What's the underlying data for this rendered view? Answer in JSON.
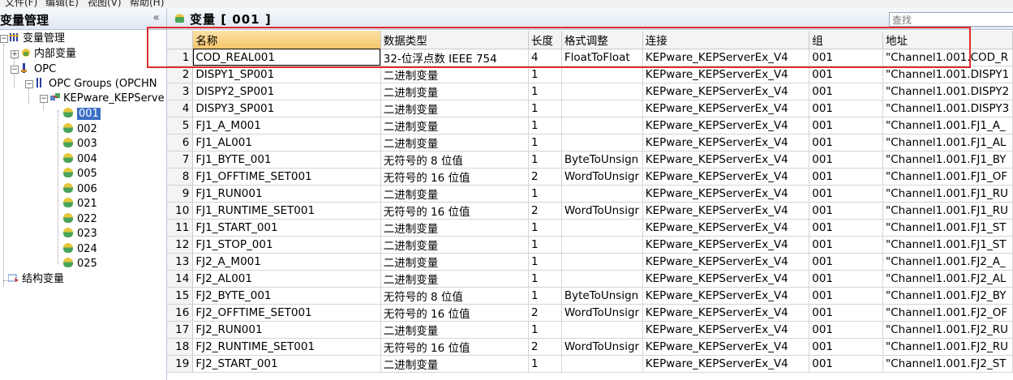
{
  "menu": {
    "items": [
      "文件(F)",
      "编辑(E)",
      "视图(V)",
      "帮助(H)"
    ]
  },
  "left_panel": {
    "title": "变量管理",
    "collapse_glyph": "«",
    "tree": {
      "root": "变量管理",
      "internal": "内部变量",
      "opc": "OPC",
      "opc_groups": "OPC Groups (OPCHN",
      "server": "KEPware_KEPServe",
      "groups": [
        "001",
        "002",
        "003",
        "004",
        "005",
        "006",
        "021",
        "022",
        "023",
        "024",
        "025"
      ],
      "struct": "结构变量"
    }
  },
  "right_panel": {
    "title": "变量 [ 001 ]",
    "search_placeholder": "查找",
    "columns": [
      "名称",
      "数据类型",
      "长度",
      "格式调整",
      "连接",
      "组",
      "地址"
    ],
    "rows": [
      [
        "1",
        "COD_REAL001",
        "32-位浮点数 IEEE 754",
        "4",
        "FloatToFloat",
        "KEPware_KEPServerEx_V4",
        "001",
        "\"Channel1.001.COD_R"
      ],
      [
        "2",
        "DISPY1_SP001",
        "二进制变量",
        "1",
        "",
        "KEPware_KEPServerEx_V4",
        "001",
        "\"Channel1.001.DISPY1"
      ],
      [
        "3",
        "DISPY2_SP001",
        "二进制变量",
        "1",
        "",
        "KEPware_KEPServerEx_V4",
        "001",
        "\"Channel1.001.DISPY2"
      ],
      [
        "4",
        "DISPY3_SP001",
        "二进制变量",
        "1",
        "",
        "KEPware_KEPServerEx_V4",
        "001",
        "\"Channel1.001.DISPY3"
      ],
      [
        "5",
        "FJ1_A_M001",
        "二进制变量",
        "1",
        "",
        "KEPware_KEPServerEx_V4",
        "001",
        "\"Channel1.001.FJ1_A_"
      ],
      [
        "6",
        "FJ1_AL001",
        "二进制变量",
        "1",
        "",
        "KEPware_KEPServerEx_V4",
        "001",
        "\"Channel1.001.FJ1_AL"
      ],
      [
        "7",
        "FJ1_BYTE_001",
        "无符号的 8 位值",
        "1",
        "ByteToUnsign",
        "KEPware_KEPServerEx_V4",
        "001",
        "\"Channel1.001.FJ1_BY"
      ],
      [
        "8",
        "FJ1_OFFTIME_SET001",
        "无符号的 16 位值",
        "2",
        "WordToUnsigr",
        "KEPware_KEPServerEx_V4",
        "001",
        "\"Channel1.001.FJ1_OF"
      ],
      [
        "9",
        "FJ1_RUN001",
        "二进制变量",
        "1",
        "",
        "KEPware_KEPServerEx_V4",
        "001",
        "\"Channel1.001.FJ1_RU"
      ],
      [
        "10",
        "FJ1_RUNTIME_SET001",
        "无符号的 16 位值",
        "2",
        "WordToUnsigr",
        "KEPware_KEPServerEx_V4",
        "001",
        "\"Channel1.001.FJ1_RU"
      ],
      [
        "11",
        "FJ1_START_001",
        "二进制变量",
        "1",
        "",
        "KEPware_KEPServerEx_V4",
        "001",
        "\"Channel1.001.FJ1_ST"
      ],
      [
        "12",
        "FJ1_STOP_001",
        "二进制变量",
        "1",
        "",
        "KEPware_KEPServerEx_V4",
        "001",
        "\"Channel1.001.FJ1_ST"
      ],
      [
        "13",
        "FJ2_A_M001",
        "二进制变量",
        "1",
        "",
        "KEPware_KEPServerEx_V4",
        "001",
        "\"Channel1.001.FJ2_A_"
      ],
      [
        "14",
        "FJ2_AL001",
        "二进制变量",
        "1",
        "",
        "KEPware_KEPServerEx_V4",
        "001",
        "\"Channel1.001.FJ2_AL"
      ],
      [
        "15",
        "FJ2_BYTE_001",
        "无符号的 8 位值",
        "1",
        "ByteToUnsign",
        "KEPware_KEPServerEx_V4",
        "001",
        "\"Channel1.001.FJ2_BY"
      ],
      [
        "16",
        "FJ2_OFFTIME_SET001",
        "无符号的 16 位值",
        "2",
        "WordToUnsigr",
        "KEPware_KEPServerEx_V4",
        "001",
        "\"Channel1.001.FJ2_OF"
      ],
      [
        "17",
        "FJ2_RUN001",
        "二进制变量",
        "1",
        "",
        "KEPware_KEPServerEx_V4",
        "001",
        "\"Channel1.001.FJ2_RU"
      ],
      [
        "18",
        "FJ2_RUNTIME_SET001",
        "无符号的 16 位值",
        "2",
        "WordToUnsigr",
        "KEPware_KEPServerEx_V4",
        "001",
        "\"Channel1.001.FJ2_RU"
      ],
      [
        "19",
        "FJ2_START_001",
        "二进制变量",
        "1",
        "",
        "KEPware_KEPServerEx_V4",
        "001",
        "\"Channel1.001.FJ2_ST"
      ]
    ]
  },
  "colors": {
    "annotation": "#e02b2b",
    "selection": "#3a6fc4",
    "active_header": "#f6c66c"
  }
}
